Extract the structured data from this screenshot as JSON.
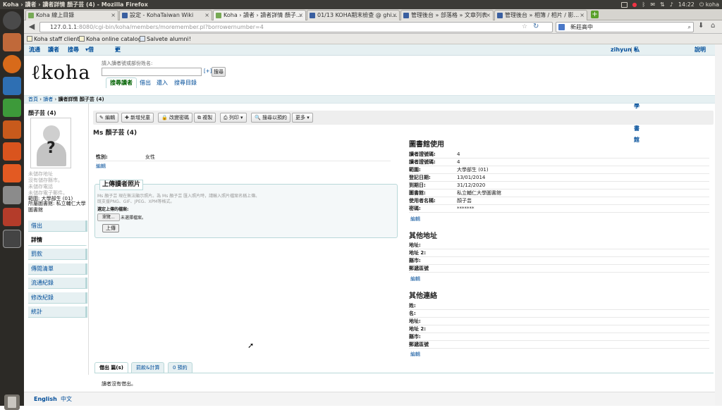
{
  "window": {
    "title": "Koha › 讀者 › 讀者詳情 顏子芸 (4) - Mozilla Firefox"
  },
  "system_tray": {
    "time": "14:22",
    "user": "koha"
  },
  "browser": {
    "tabs": [
      {
        "label": "Koha 線上目錄"
      },
      {
        "label": "設定 - KohaTaiwan Wiki"
      },
      {
        "label": "Koha › 讀者 › 讀者詳情 顏子..."
      },
      {
        "label": "01/13 KOHA期末檢查 @ ghi..."
      },
      {
        "label": "管理後台 » 部落格 » 文章列表"
      },
      {
        "label": "管理後台 » 相簿 / 相片 / 影..."
      }
    ],
    "url_host": "127.0.1.1",
    "url_rest": ":8080/cgi-bin/koha/members/moremember.pl?borrowernumber=4",
    "search_query": "新莊高中",
    "bookmarks": [
      {
        "label": "Koha staff client"
      },
      {
        "label": "Koha online catalog"
      },
      {
        "label": "Salvete alumni!"
      }
    ]
  },
  "koha": {
    "topnav": {
      "items": [
        "流通",
        "讀者",
        "搜尋",
        "借出籃",
        "更多"
      ],
      "user": "zihyun",
      "separator": "|",
      "library": "私立輔仁大學圖書館",
      "help": "說明"
    },
    "logo_text": "koha",
    "search": {
      "label": "請入讀者號或部份姓名:",
      "expand": "[+]",
      "button": "搜尋",
      "tabs": [
        "搜尋讀者",
        "借出",
        "還入",
        "搜尋目錄"
      ]
    },
    "breadcrumb": {
      "home": "首頁",
      "patrons": "讀者",
      "current": "讀者詳情 顏子芸 (4)"
    },
    "sidebar": {
      "name": "顏子芸 (4)",
      "missing": [
        "未儲存地址",
        "沒有儲存縣市。",
        "未儲存電話",
        "未儲存電子郵件。"
      ],
      "category": "範圍: 大學部生 (01)",
      "home_library_label": "所屬圖書館:",
      "home_library": "私立輔仁大學圖書館",
      "menu": [
        "借出",
        "詳情",
        "罰款",
        "傳閱清單",
        "流通紀錄",
        "修改紀錄",
        "統計"
      ]
    },
    "toolbar": {
      "buttons": [
        "✎ 編輯",
        "✚ 新增兒童",
        "🔒 改變密碼",
        "⧉ 複製",
        "⎙ 列印 ▾",
        "🔍 搜尋以預約",
        "更多 ▾"
      ]
    },
    "patron_title": "Ms 顏子芸 (4)",
    "gender_label": "性別:",
    "gender": "女性",
    "edit": "編輯",
    "upload": {
      "legend": "上傳讀者照片",
      "hint1": "Ms 顏子芸 現在無法顯示照片。為 Ms 顏子芸 匯入照片時，請輸入照片檔案名稱上傳。",
      "hint2": "既支援PNG、GIF、JPEG、XPM等格式。",
      "select_label": "選定上傳的檔案:",
      "browse": "瀏覽...",
      "no_file": "未選擇檔案。",
      "button": "上傳"
    },
    "library_use": {
      "heading": "圖書館使用",
      "rows": [
        {
          "k": "讀者證號碼:",
          "v": "4"
        },
        {
          "k": "讀者證號碼:",
          "v": "4"
        },
        {
          "k": "範圍:",
          "v": "大學部生 (01)"
        },
        {
          "k": "登記日期:",
          "v": "13/01/2014"
        },
        {
          "k": "到期日:",
          "v": "31/12/2020"
        },
        {
          "k": "圖書館:",
          "v": "私立輔仁大學圖書館"
        },
        {
          "k": "使用者名稱:",
          "v": "顏子芸"
        },
        {
          "k": "密碼:",
          "v": "*******"
        }
      ]
    },
    "alt_address": {
      "heading": "其他地址",
      "rows": [
        {
          "k": "地址:",
          "v": ""
        },
        {
          "k": "地址 2:",
          "v": ""
        },
        {
          "k": "縣市:",
          "v": ""
        },
        {
          "k": "郵遞區號",
          "v": ""
        }
      ]
    },
    "alt_contact": {
      "heading": "其他連絡",
      "rows": [
        {
          "k": "姓:",
          "v": ""
        },
        {
          "k": "名:",
          "v": ""
        },
        {
          "k": "地址:",
          "v": ""
        },
        {
          "k": "地址 2:",
          "v": ""
        },
        {
          "k": "縣市:",
          "v": ""
        },
        {
          "k": "郵遞區號",
          "v": ""
        }
      ]
    },
    "bottom_tabs": [
      "借出 篇(s)",
      "罰款&計算",
      "0 預約"
    ],
    "no_checkouts": "讀者沒有借出。",
    "languages": [
      "English",
      "中文"
    ]
  }
}
